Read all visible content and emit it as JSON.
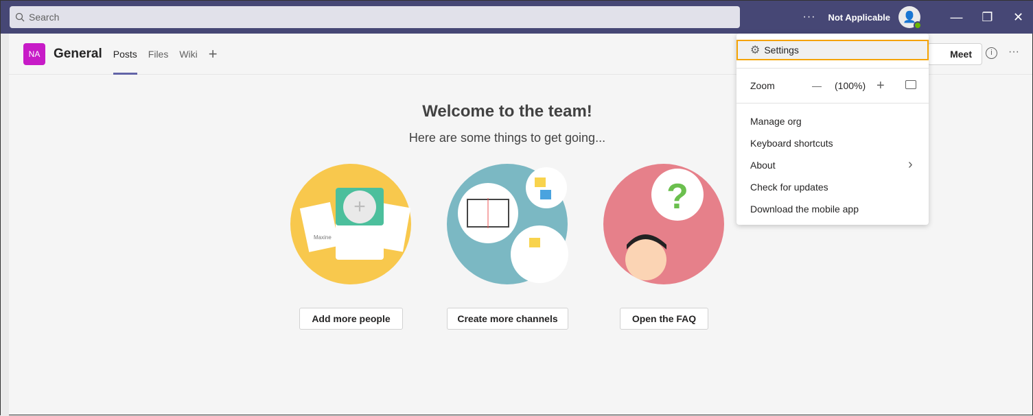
{
  "topbar": {
    "search_placeholder": "Search",
    "more": "···",
    "user_name": "Not Applicable",
    "minimize": "—",
    "restore": "❐",
    "close": "✕"
  },
  "header": {
    "team_initials": "NA",
    "channel": "General",
    "tabs": [
      {
        "label": "Posts",
        "active": true
      },
      {
        "label": "Files"
      },
      {
        "label": "Wiki"
      }
    ],
    "add_tab": "+",
    "meet": "Meet",
    "info": "i",
    "more": "···"
  },
  "welcome": {
    "title": "Welcome to the team!",
    "subtitle": "Here are some things to get going...",
    "actions": [
      {
        "label": "Add more people"
      },
      {
        "label": "Create more channels"
      },
      {
        "label": "Open the FAQ"
      }
    ],
    "card_name": "Maxine"
  },
  "menu": {
    "settings": "Settings",
    "zoom_label": "Zoom",
    "zoom_minus": "—",
    "zoom_value": "(100%)",
    "zoom_plus": "+",
    "items": [
      "Manage org",
      "Keyboard shortcuts",
      "About",
      "Check for updates",
      "Download the mobile app"
    ],
    "about_chevron": "›"
  },
  "colors": {
    "topbar": "#464775",
    "accent": "#6264a7",
    "highlight": "#f5a300",
    "team": "#c71bc7"
  }
}
